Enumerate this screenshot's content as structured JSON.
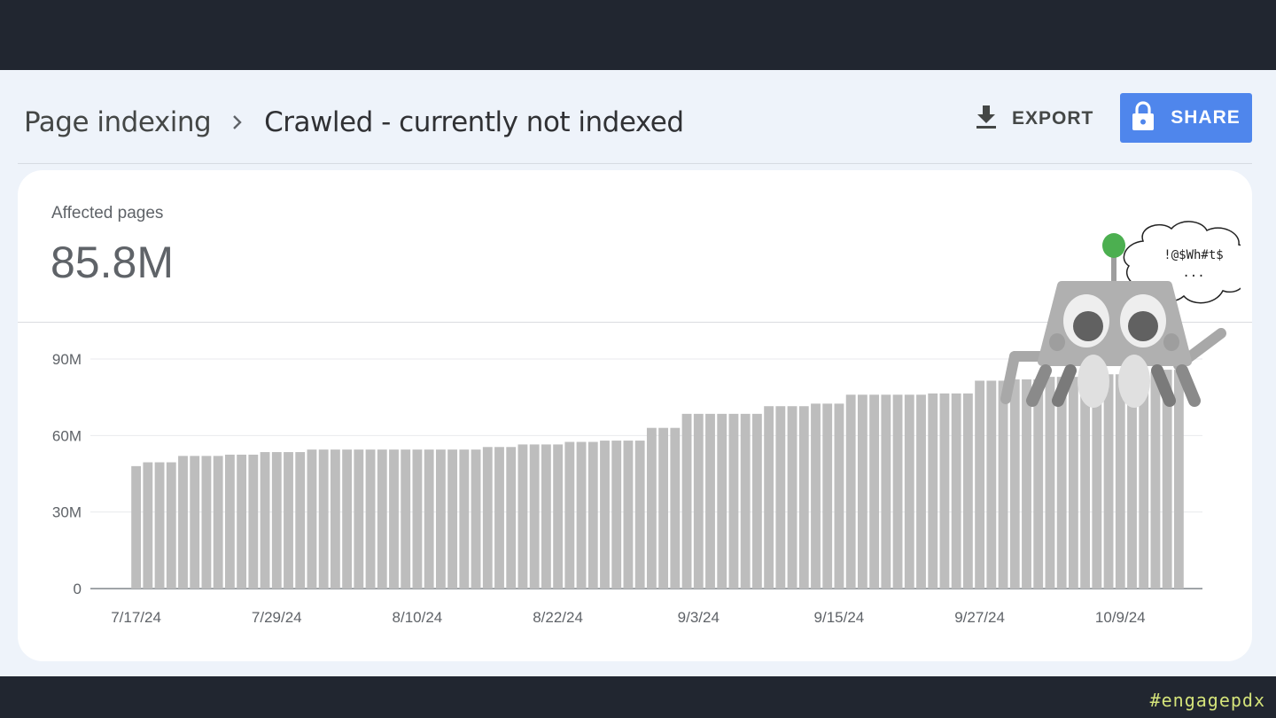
{
  "breadcrumb": {
    "root": "Page indexing",
    "current": "Crawled - currently not indexed"
  },
  "toolbar": {
    "export_label": "EXPORT",
    "share_label": "SHARE"
  },
  "metric": {
    "label": "Affected pages",
    "value": "85.8M"
  },
  "mascot": {
    "speech_line1": "!@$Wh#t$",
    "speech_line2": "..."
  },
  "footer": {
    "hashtag": "#engagepdx"
  },
  "colors": {
    "accent": "#4f86ec",
    "bar": "#bdbdbd",
    "dark_frame": "#212630",
    "panel_bg": "#eef3fa"
  },
  "chart_data": {
    "type": "bar",
    "x_ticks": [
      "7/17/24",
      "7/29/24",
      "8/10/24",
      "8/22/24",
      "9/3/24",
      "9/15/24",
      "9/27/24",
      "10/9/24"
    ],
    "y_ticks": [
      "0",
      "30M",
      "60M",
      "90M"
    ],
    "ylim": [
      0,
      90000000
    ],
    "x_start": "7/17/24",
    "x_end": "10/14/24",
    "grid": true,
    "values": [
      48000000,
      49500000,
      49500000,
      49500000,
      52000000,
      52000000,
      52000000,
      52000000,
      52500000,
      52500000,
      52500000,
      53500000,
      53500000,
      53500000,
      53500000,
      54500000,
      54500000,
      54500000,
      54500000,
      54500000,
      54500000,
      54500000,
      54500000,
      54500000,
      54500000,
      54500000,
      54500000,
      54500000,
      54500000,
      54500000,
      55500000,
      55500000,
      55500000,
      56500000,
      56500000,
      56500000,
      56500000,
      57500000,
      57500000,
      57500000,
      58000000,
      58000000,
      58000000,
      58000000,
      63000000,
      63000000,
      63000000,
      68500000,
      68500000,
      68500000,
      68500000,
      68500000,
      68500000,
      68500000,
      71500000,
      71500000,
      71500000,
      71500000,
      72500000,
      72500000,
      72500000,
      76000000,
      76000000,
      76000000,
      76000000,
      76000000,
      76000000,
      76000000,
      76500000,
      76500000,
      76500000,
      76500000,
      81500000,
      81500000,
      81500000,
      82000000,
      82000000,
      82000000,
      83000000,
      83000000,
      83000000,
      83500000,
      83500000,
      84000000,
      84000000,
      84500000,
      84500000,
      85000000,
      85800000,
      85800000
    ]
  }
}
